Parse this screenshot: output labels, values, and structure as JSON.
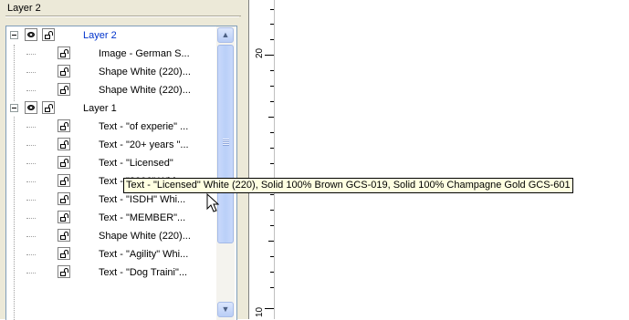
{
  "panel": {
    "title": "Layer 2"
  },
  "tree": {
    "rows": [
      {
        "label": "Layer 2",
        "kind": "layer",
        "selected": true
      },
      {
        "label": "Image - German S...",
        "kind": "item"
      },
      {
        "label": "Shape White (220)...",
        "kind": "item"
      },
      {
        "label": "Shape White (220)...",
        "kind": "item"
      },
      {
        "label": "Layer 1",
        "kind": "layer",
        "selected": false
      },
      {
        "label": "Text - \"of experie\" ...",
        "kind": "item"
      },
      {
        "label": "Text - \"20+ years \"...",
        "kind": "item"
      },
      {
        "label": "Text - \"Licensed\"",
        "kind": "item"
      },
      {
        "label": "Text - \"2006\" Whi...",
        "kind": "item"
      },
      {
        "label": "Text - \"ISDH\" Whi...",
        "kind": "item"
      },
      {
        "label": "Text - \"MEMBER\"...",
        "kind": "item"
      },
      {
        "label": "Shape White (220)...",
        "kind": "item"
      },
      {
        "label": "Text - \"Agility\" Whi...",
        "kind": "item"
      },
      {
        "label": "Text - \"Dog Traini\"...",
        "kind": "item"
      }
    ]
  },
  "tooltip": {
    "text": "Text - \"Licensed\" White (220), Solid 100% Brown GCS-019, Solid 100% Champagne Gold GCS-601"
  },
  "ruler": {
    "labels": [
      "20",
      "10"
    ]
  },
  "icons": {
    "visibility": "eye-icon",
    "lock": "lock-icon",
    "expand": "collapse-icon",
    "scroll_up": "scroll-up-icon",
    "scroll_down": "scroll-down-icon"
  }
}
